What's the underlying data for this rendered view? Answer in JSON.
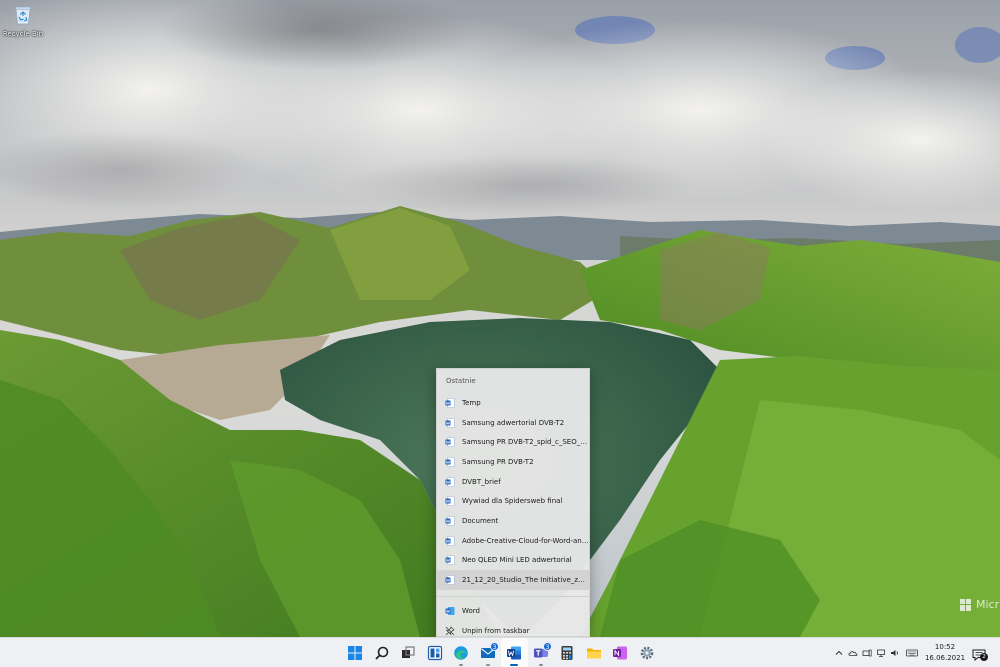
{
  "desktop": {
    "recycle_bin_label": "Recycle Bin",
    "recycle_bin_icon": "recycle-bin-icon"
  },
  "watermark": {
    "text": "Micr"
  },
  "jumplist": {
    "heading": "Ostatnie",
    "recent": [
      "Temp",
      "Samsung adwertorial DVB-T2",
      "Samsung PR DVB-T2_spid_c_SEO_2021...",
      "Samsung PR DVB-T2",
      "DVBT_brief",
      "Wywiad dla Spidersweb final",
      "Document",
      "Adobe-Creative-Cloud-for-Word-and-...",
      "Neo QLED Mini LED adwertorial",
      "21_12_20_Studio_The Initiative_zdradz..."
    ],
    "actions": {
      "open_app": "Word",
      "unpin": "Unpin from taskbar"
    }
  },
  "taskbar": {
    "apps": [
      {
        "name": "start",
        "icon": "windows-start-icon"
      },
      {
        "name": "search",
        "icon": "search-icon"
      },
      {
        "name": "task-view",
        "icon": "task-view-icon"
      },
      {
        "name": "widgets",
        "icon": "widgets-icon"
      },
      {
        "name": "edge",
        "icon": "edge-icon"
      },
      {
        "name": "mail",
        "icon": "mail-icon",
        "badge": "3"
      },
      {
        "name": "word",
        "icon": "word-icon"
      },
      {
        "name": "teams",
        "icon": "teams-icon",
        "badge": "3"
      },
      {
        "name": "calculator",
        "icon": "calculator-icon"
      },
      {
        "name": "file-explorer",
        "icon": "folder-icon"
      },
      {
        "name": "onenote",
        "icon": "onenote-icon"
      },
      {
        "name": "settings",
        "icon": "gear-icon"
      }
    ],
    "clock": {
      "time": "10:52",
      "date": "16.06.2021"
    },
    "notification_count": "2"
  },
  "colors": {
    "accent": "#0067c0",
    "word_blue": "#185abd",
    "taskbar_bg": "#eef0f3"
  }
}
